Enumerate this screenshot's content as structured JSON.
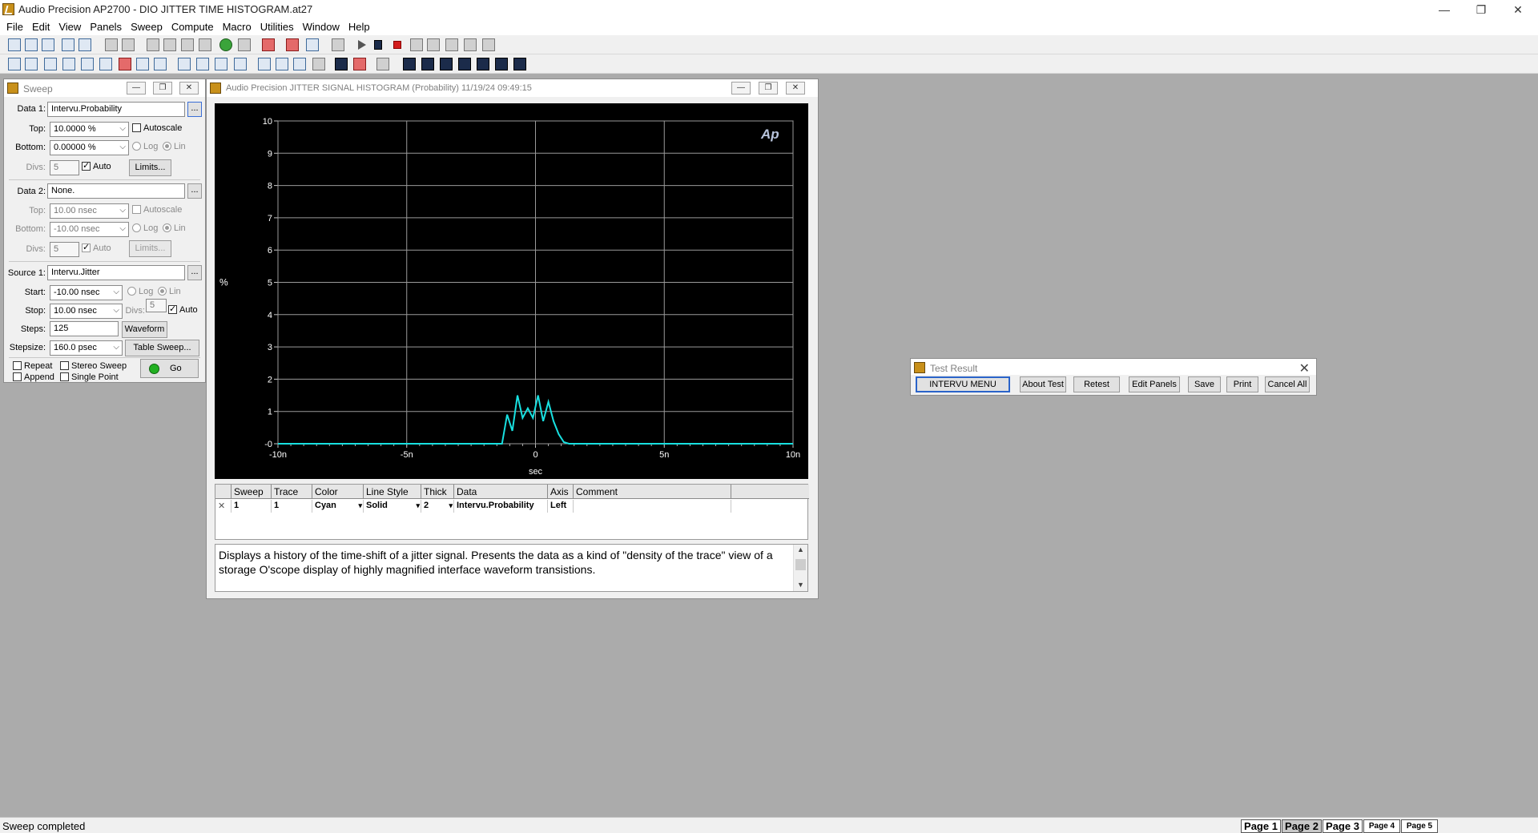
{
  "app": {
    "title": "Audio Precision AP2700 - DIO JITTER TIME HISTOGRAM.at27",
    "minimize_glyph": "—",
    "restore_glyph": "❐",
    "close_glyph": "✕"
  },
  "menu": [
    "File",
    "Edit",
    "View",
    "Panels",
    "Sweep",
    "Compute",
    "Macro",
    "Utilities",
    "Window",
    "Help"
  ],
  "sweep_panel": {
    "title": "Sweep",
    "data1": {
      "label": "Data 1:",
      "value": "Intervu.Probability",
      "browse": "...",
      "top_label": "Top:",
      "top_value": "10.0000  %",
      "autoscale": "Autoscale",
      "bottom_label": "Bottom:",
      "bottom_value": "0.00000  %",
      "log": "Log",
      "lin": "Lin",
      "divs_label": "Divs:",
      "divs_value": "5",
      "auto": "Auto",
      "limits": "Limits..."
    },
    "data2": {
      "label": "Data 2:",
      "value": "None.",
      "browse": "...",
      "top_label": "Top:",
      "top_value": "10.00  nsec",
      "autoscale": "Autoscale",
      "bottom_label": "Bottom:",
      "bottom_value": "-10.00  nsec",
      "log": "Log",
      "lin": "Lin",
      "divs_label": "Divs:",
      "divs_value": "5",
      "auto": "Auto",
      "limits": "Limits..."
    },
    "source1": {
      "label": "Source 1:",
      "value": "Intervu.Jitter",
      "browse": "...",
      "start_label": "Start:",
      "start_value": "-10.00  nsec",
      "log": "Log",
      "lin": "Lin",
      "stop_label": "Stop:",
      "stop_value": "10.00  nsec",
      "divs_label": "Divs:",
      "divs_value": "5",
      "auto": "Auto",
      "steps_label": "Steps:",
      "steps_value": "125",
      "waveform": "Waveform",
      "stepsize_label": "Stepsize:",
      "stepsize_value": "160.0  psec",
      "table_sweep": "Table Sweep..."
    },
    "options": {
      "repeat": "Repeat",
      "stereo": "Stereo Sweep",
      "append": "Append",
      "single": "Single Point",
      "go": "Go"
    }
  },
  "graph_window": {
    "title": "Audio Precision  JITTER SIGNAL HISTOGRAM (Probability)    11/19/24 09:49:15",
    "logo": "Ap"
  },
  "chart_data": {
    "type": "line",
    "title": "",
    "xlabel": "sec",
    "ylabel": "%",
    "xlim": [
      -10,
      10
    ],
    "ylim": [
      0,
      10
    ],
    "x_unit_scale": "nsec",
    "xticks": [
      "-10n",
      "-5n",
      "0",
      "5n",
      "10n"
    ],
    "yticks": [
      "-0",
      "1",
      "2",
      "3",
      "4",
      "5",
      "6",
      "7",
      "8",
      "9",
      "10"
    ],
    "grid": true,
    "series": [
      {
        "color": "#18e0e0",
        "x": [
          -10,
          -1.3,
          -1.1,
          -0.9,
          -0.7,
          -0.5,
          -0.3,
          -0.1,
          0.1,
          0.3,
          0.5,
          0.7,
          0.9,
          1.1,
          1.3,
          10
        ],
        "y": [
          0,
          0,
          0.9,
          0.4,
          1.5,
          0.8,
          1.1,
          0.8,
          1.5,
          0.7,
          1.3,
          0.7,
          0.3,
          0.05,
          0,
          0
        ]
      }
    ]
  },
  "trace_table": {
    "headers": [
      "Sweep",
      "Trace",
      "Color",
      "Line Style",
      "Thick",
      "Data",
      "Axis",
      "Comment"
    ],
    "row": {
      "sweep": "1",
      "trace": "1",
      "color": "Cyan",
      "line_style": "Solid",
      "thick": "2",
      "data": "Intervu.Probability",
      "axis": "Left",
      "comment": ""
    }
  },
  "description": {
    "text": "Displays a history of the time-shift of a jitter signal.    Presents the data as a kind of \"density of the trace\" view of a storage O'scope display of  highly magnified interface waveform transistions."
  },
  "test_result": {
    "title": "Test Result",
    "buttons": [
      "INTERVU  MENU",
      "About Test",
      "Retest",
      "Edit Panels",
      "Save",
      "Print",
      "Cancel All"
    ]
  },
  "status": {
    "text": "Sweep completed",
    "pages": [
      "Page 1",
      "Page 2",
      "Page 3",
      "Page 4",
      "Page 5"
    ],
    "active_page": "Page 2"
  }
}
